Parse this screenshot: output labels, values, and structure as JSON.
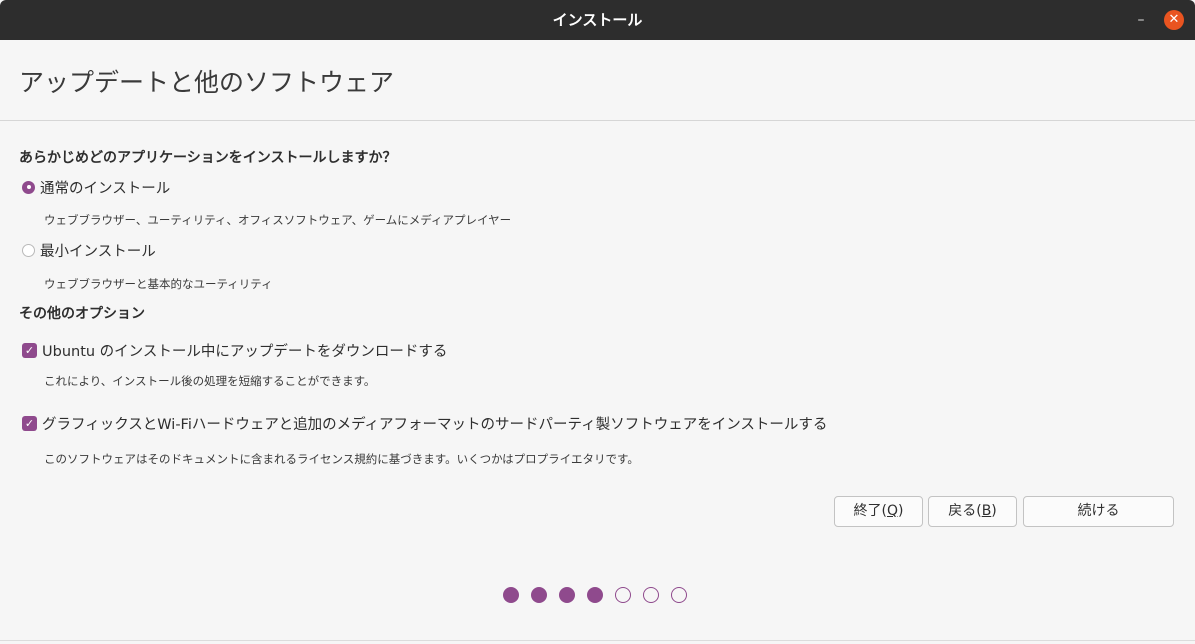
{
  "window": {
    "title": "インストール",
    "minimize_symbol": "–",
    "close_symbol": "✕",
    "close_color": "#e95420"
  },
  "page": {
    "title": "アップデートと他のソフトウェア"
  },
  "install_type": {
    "heading": "あらかじめどのアプリケーションをインストールしますか？",
    "normal": {
      "label": "通常のインストール",
      "description": "ウェブブラウザー、ユーティリティ、オフィスソフトウェア、ゲームにメディアプレイヤー",
      "selected": true
    },
    "minimal": {
      "label": "最小インストール",
      "description": "ウェブブラウザーと基本的なユーティリティ",
      "selected": false
    }
  },
  "other_options": {
    "heading": "その他のオプション",
    "updates": {
      "label": "Ubuntu のインストール中にアップデートをダウンロードする",
      "description": "これにより、インストール後の処理を短縮することができます。",
      "checked": true
    },
    "third_party": {
      "label": "グラフィックスとWi-Fiハードウェアと追加のメディアフォーマットのサードパーティ製ソフトウェアをインストールする",
      "description": "このソフトウェアはそのドキュメントに含まれるライセンス規約に基づきます。いくつかはプロプライエタリです。",
      "checked": true
    }
  },
  "buttons": {
    "quit": {
      "label": "終了",
      "mnemonic": "Q"
    },
    "back": {
      "label": "戻る",
      "mnemonic": "B"
    },
    "continue": {
      "label": "続ける"
    }
  },
  "progress": {
    "current_step": 4,
    "total_steps": 7
  },
  "colors": {
    "accent": "#8f4a8d",
    "titlebar": "#2d2d2d",
    "background": "#f6f6f6"
  }
}
